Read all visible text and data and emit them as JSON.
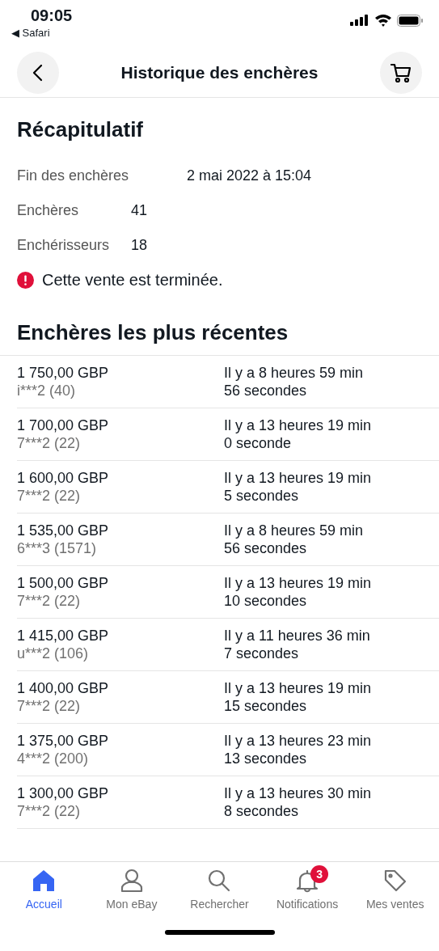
{
  "status_bar": {
    "time": "09:05",
    "back_app": "◀ Safari"
  },
  "header": {
    "title": "Historique des enchères"
  },
  "summary": {
    "title": "Récapitulatif",
    "rows": [
      {
        "label": "Fin des enchères",
        "value": "2 mai 2022 à 15:04"
      },
      {
        "label": "Enchères",
        "value": "41"
      },
      {
        "label": "Enchérisseurs",
        "value": "18"
      }
    ],
    "alert": "Cette vente est terminée."
  },
  "bids": {
    "title": "Enchères les plus récentes",
    "rows": [
      {
        "amount": "1 750,00 GBP",
        "bidder": "i***2 (40)",
        "time": "Il y a 8 heures 59 min",
        "time_2": "56 secondes"
      },
      {
        "amount": "1 700,00 GBP",
        "bidder": "7***2 (22)",
        "time": "Il y a 13 heures 19 min",
        "time_2": "0 seconde"
      },
      {
        "amount": "1 600,00 GBP",
        "bidder": "7***2 (22)",
        "time": "Il y a 13 heures 19 min",
        "time_2": "5 secondes"
      },
      {
        "amount": "1 535,00 GBP",
        "bidder": "6***3 (1571)",
        "time": "Il y a 8 heures 59 min",
        "time_2": "56 secondes"
      },
      {
        "amount": "1 500,00 GBP",
        "bidder": "7***2 (22)",
        "time": "Il y a 13 heures 19 min",
        "time_2": "10 secondes"
      },
      {
        "amount": "1 415,00 GBP",
        "bidder": "u***2 (106)",
        "time": "Il y a 11 heures 36 min",
        "time_2": "7 secondes"
      },
      {
        "amount": "1 400,00 GBP",
        "bidder": "7***2 (22)",
        "time": "Il y a 13 heures 19 min",
        "time_2": "15 secondes"
      },
      {
        "amount": "1 375,00 GBP",
        "bidder": "4***2 (200)",
        "time": "Il y a 13 heures 23 min",
        "time_2": "13 secondes"
      },
      {
        "amount": "1 300,00 GBP",
        "bidder": "7***2 (22)",
        "time": "Il y a 13 heures 30 min",
        "time_2": "8 secondes"
      }
    ]
  },
  "tab_bar": [
    {
      "kind": "home",
      "label": "Accueil",
      "selected": true
    },
    {
      "kind": "profile",
      "label": "Mon eBay",
      "selected": false
    },
    {
      "kind": "search",
      "label": "Rechercher",
      "selected": false
    },
    {
      "kind": "bell",
      "label": "Notifications",
      "selected": false,
      "badge": "3"
    },
    {
      "kind": "tag",
      "label": "Mes ventes",
      "selected": false
    }
  ]
}
